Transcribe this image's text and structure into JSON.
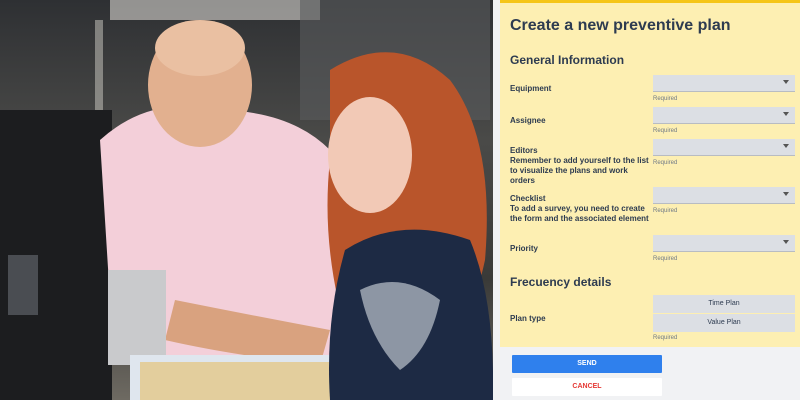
{
  "form": {
    "title": "Create a new preventive plan",
    "general_section": "General Information",
    "fields": [
      {
        "label": "Equipment",
        "value": "",
        "required": "Required"
      },
      {
        "label": "Assignee",
        "value": "",
        "required": "Required"
      },
      {
        "label": "Editors\nRemember to add yourself to the list to visualize the plans and work orders",
        "value": "",
        "required": "Required"
      },
      {
        "label": "Checklist\nTo add a survey, you need to create the form and the associated element",
        "value": "",
        "required": "Required"
      },
      {
        "label": "Priority",
        "value": "",
        "required": "Required"
      }
    ],
    "frequency_section": "Frecuency details",
    "plan_type": {
      "label": "Plan type",
      "options": [
        "Time Plan",
        "Value Plan"
      ],
      "required": "Required"
    }
  },
  "actions": {
    "send": "SEND",
    "cancel": "CANCEL"
  },
  "colors": {
    "form_background": "#fdefb2",
    "form_accent": "#f5c518",
    "heading": "#2d3b50",
    "send_button": "#2f80ed",
    "cancel_text": "#e53935"
  },
  "photo": {
    "description_icon": "photo-of-two-people-at-laptop"
  }
}
